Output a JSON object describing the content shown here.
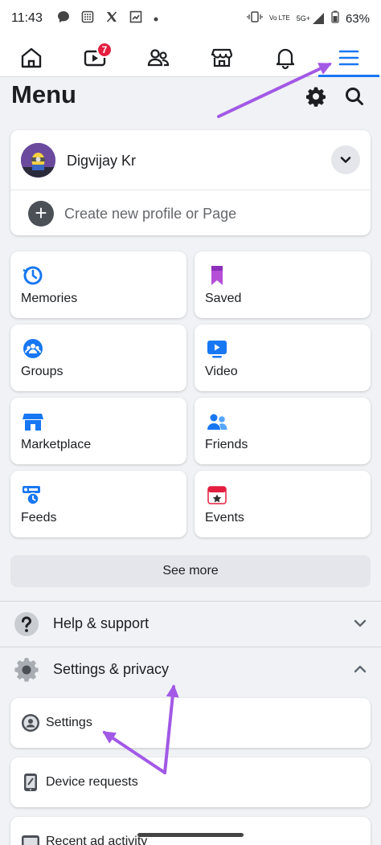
{
  "status_bar": {
    "time": "11:43",
    "network_top": "Vo LTE",
    "network_5g": "5G+",
    "battery": "63%"
  },
  "nav": {
    "tabs": [
      {
        "name": "home-tab",
        "icon": "home-icon"
      },
      {
        "name": "video-tab",
        "icon": "video-icon",
        "badge": "7"
      },
      {
        "name": "friends-tab",
        "icon": "friends-icon"
      },
      {
        "name": "marketplace-tab",
        "icon": "marketplace-icon"
      },
      {
        "name": "notifications-tab",
        "icon": "bell-icon"
      },
      {
        "name": "menu-tab",
        "icon": "hamburger-icon",
        "active": true
      }
    ],
    "video_badge": "7",
    "accent": "#1877f2"
  },
  "header": {
    "title": "Menu"
  },
  "profile": {
    "name": "Digvijay Kr",
    "create_label": "Create new profile or Page"
  },
  "shortcuts": [
    {
      "label": "Memories",
      "icon": "memories-icon",
      "color": "#1877f2"
    },
    {
      "label": "Saved",
      "icon": "bookmark-icon",
      "color": "#b44fd6"
    },
    {
      "label": "Groups",
      "icon": "groups-icon",
      "color": "#1877f2"
    },
    {
      "label": "Video",
      "icon": "video-icon",
      "color": "#1877f2"
    },
    {
      "label": "Marketplace",
      "icon": "marketplace-icon",
      "color": "#1877f2"
    },
    {
      "label": "Friends",
      "icon": "friends-icon",
      "color": "#1877f2"
    },
    {
      "label": "Feeds",
      "icon": "feeds-icon",
      "color": "#1877f2"
    },
    {
      "label": "Events",
      "icon": "calendar-icon",
      "color": "#e41e3f"
    }
  ],
  "see_more": "See more",
  "sections": {
    "help": "Help & support",
    "settings_privacy": "Settings & privacy"
  },
  "settings_items": [
    {
      "label": "Settings",
      "icon": "account-settings-icon"
    },
    {
      "label": "Device requests",
      "icon": "device-icon"
    },
    {
      "label": "Recent ad activity",
      "icon": "ad-activity-icon"
    }
  ],
  "annotation_color": "#a259e6"
}
